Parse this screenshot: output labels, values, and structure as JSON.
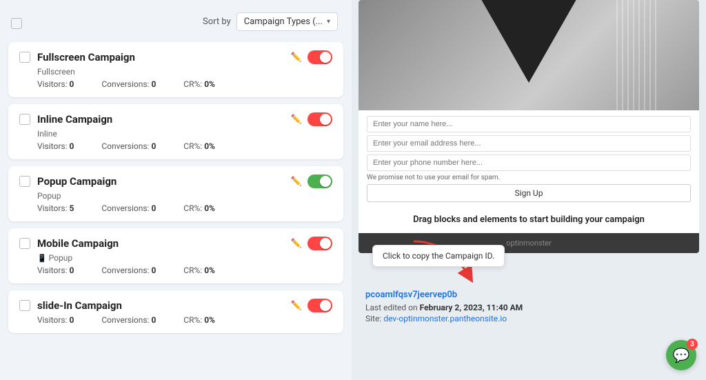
{
  "header": {
    "sort_label": "Sort by",
    "sort_value": "Campaign Types (...",
    "sort_arrow": "▾"
  },
  "campaigns": [
    {
      "id": "fullscreen",
      "title": "Fullscreen Campaign",
      "type": "Fullscreen",
      "visitors": 0,
      "conversions": 0,
      "cr": "0%",
      "toggle_state": "on",
      "phone_icon": false
    },
    {
      "id": "inline",
      "title": "Inline Campaign",
      "type": "Inline",
      "visitors": 0,
      "conversions": 0,
      "cr": "0%",
      "toggle_state": "on",
      "phone_icon": false
    },
    {
      "id": "popup",
      "title": "Popup Campaign",
      "type": "Popup",
      "visitors": 5,
      "conversions": 0,
      "cr": "0%",
      "toggle_state": "green",
      "phone_icon": false
    },
    {
      "id": "mobile",
      "title": "Mobile Campaign",
      "type": "Popup",
      "visitors": 0,
      "conversions": 0,
      "cr": "0%",
      "toggle_state": "on",
      "phone_icon": true
    },
    {
      "id": "slidein",
      "title": "slide-In Campaign",
      "type": "",
      "visitors": 0,
      "conversions": 0,
      "cr": "0%",
      "toggle_state": "on",
      "phone_icon": false
    }
  ],
  "preview": {
    "form_inputs": [
      "Enter your name here...",
      "Enter your email address here...",
      "Enter your phone number here..."
    ],
    "form_note": "We promise not to use your email for spam.",
    "form_button": "Sign Up",
    "cta_text": "Drag blocks and elements to start building your campaign",
    "footer_brand": "optinmonster"
  },
  "tooltip": {
    "text": "Click to copy the Campaign ID."
  },
  "campaign_info": {
    "link_text": "pcoamlfqsv7jeervep0b",
    "last_edited_prefix": "Last edited on",
    "last_edited_date": "February 2, 2023, 11:40 AM",
    "site_prefix": "Site:",
    "site_url": "dev-optinmonster.pantheonsite.io"
  },
  "chat": {
    "badge_count": "3",
    "icon": "💬"
  },
  "labels": {
    "visitors": "Visitors:",
    "conversions": "Conversions:",
    "cr": "CR%:"
  }
}
